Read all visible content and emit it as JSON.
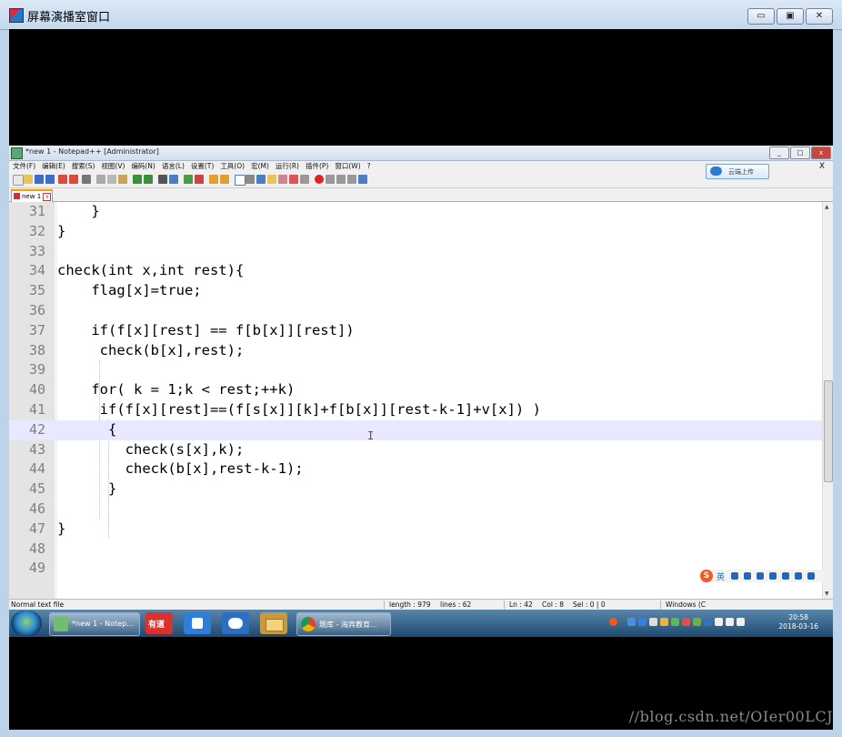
{
  "outer_window": {
    "title": "屏幕演播室窗口",
    "min": "▭",
    "max": "▣",
    "close": "✕"
  },
  "npp": {
    "title": "*new 1 - Notepad++ [Administrator]",
    "menu": [
      "文件(F)",
      "编辑(E)",
      "搜索(S)",
      "视图(V)",
      "编码(N)",
      "语言(L)",
      "设置(T)",
      "工具(O)",
      "宏(M)",
      "运行(R)",
      "插件(P)",
      "窗口(W)",
      "?"
    ],
    "menu_close": "X",
    "upload_label": "云端上传",
    "tab_label": "new 1",
    "tab_close": "x",
    "lines": [
      {
        "n": "31",
        "code": "    }"
      },
      {
        "n": "32",
        "code": "}"
      },
      {
        "n": "33",
        "code": ""
      },
      {
        "n": "34",
        "code": "check(int x,int rest){"
      },
      {
        "n": "35",
        "code": "    flag[x]=true;"
      },
      {
        "n": "36",
        "code": ""
      },
      {
        "n": "37",
        "code": "    if(f[x][rest] == f[b[x]][rest])"
      },
      {
        "n": "38",
        "code": "     check(b[x],rest);"
      },
      {
        "n": "39",
        "code": ""
      },
      {
        "n": "40",
        "code": "    for( k = 1;k < rest;++k)"
      },
      {
        "n": "41",
        "code": "     if(f[x][rest]==(f[s[x]][k]+f[b[x]][rest-k-1]+v[x]) )"
      },
      {
        "n": "42",
        "code": "      {"
      },
      {
        "n": "43",
        "code": "        check(s[x],k);"
      },
      {
        "n": "44",
        "code": "        check(b[x],rest-k-1);"
      },
      {
        "n": "45",
        "code": "      }"
      },
      {
        "n": "46",
        "code": ""
      },
      {
        "n": "47",
        "code": "}"
      },
      {
        "n": "48",
        "code": ""
      },
      {
        "n": "49",
        "code": ""
      }
    ],
    "status": {
      "filetype": "Normal text file",
      "length": "length : 979",
      "lines": "lines : 62",
      "ln": "Ln : 42",
      "col": "Col : 8",
      "sel": "Sel : 0 | 0",
      "eol": "Windows (C"
    }
  },
  "ime": {
    "s": "S",
    "zh": "英"
  },
  "taskbar": {
    "npp_task": "*new 1 - Notep...",
    "youdao": "有道",
    "chrome_task": "题库 - 海宾教育...",
    "time": "20:58",
    "date": "2018-03-16"
  },
  "watermark": "//blog.csdn.net/OIer00LCJ"
}
